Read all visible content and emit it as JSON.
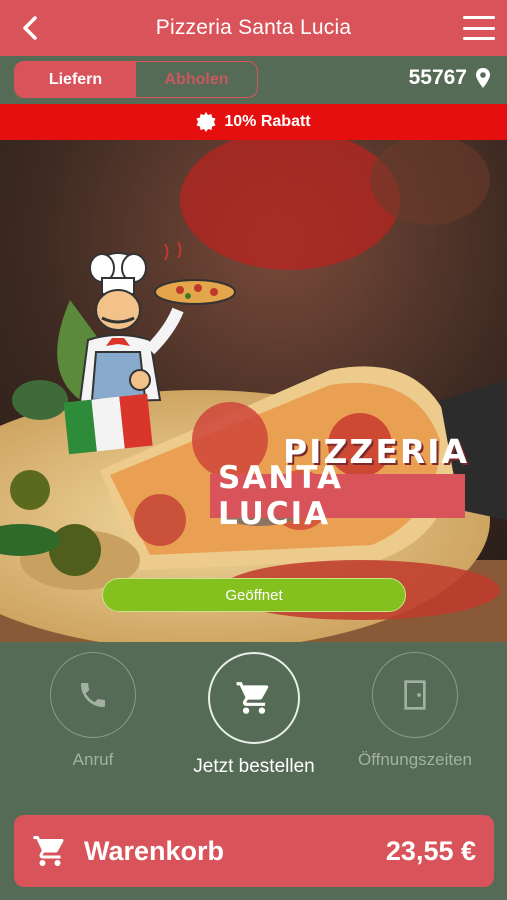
{
  "header": {
    "title": "Pizzeria Santa Lucia",
    "back_icon": "chevron-left-icon",
    "menu_icon": "hamburger-menu-icon"
  },
  "mode_toggle": {
    "deliver_label": "Liefern",
    "pickup_label": "Abholen",
    "selected": "Liefern"
  },
  "postal_code": "55767",
  "discount_banner": {
    "text": "10% Rabatt",
    "icon": "badge-icon"
  },
  "logo": {
    "line1": "PIZZERIA",
    "line2": "SANTA LUCIA"
  },
  "status": "Geöffnet",
  "actions": {
    "call_label": "Anruf",
    "order_label": "Jetzt bestellen",
    "hours_label": "Öffnungszeiten"
  },
  "cart": {
    "label": "Warenkorb",
    "total": "23,55 €"
  },
  "colors": {
    "primary": "#d9545a",
    "background": "#556b55",
    "banner": "#e60f10",
    "open_status": "#84c11f"
  }
}
